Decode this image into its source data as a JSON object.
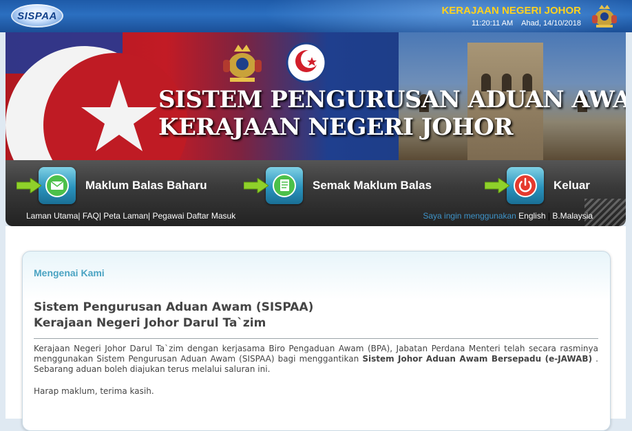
{
  "header": {
    "logo_text": "SISPAA",
    "state_name": "KERAJAAN NEGERI JOHOR",
    "time": "11:20:11 AM",
    "date": "Ahad, 14/10/2018"
  },
  "banner": {
    "title_line1": "SISTEM PENGURUSAN ADUAN AWAM",
    "title_line2": "KERAJAAN NEGERI JOHOR"
  },
  "nav": {
    "items": [
      {
        "label": "Maklum Balas Baharu",
        "icon": "envelope-icon"
      },
      {
        "label": "Semak Maklum Balas",
        "icon": "document-icon"
      },
      {
        "label": "Keluar",
        "icon": "power-icon"
      }
    ],
    "links": {
      "home": "Laman Utama",
      "faq": "FAQ",
      "sitemap": "Peta Laman",
      "officer": "Pegawai Daftar Masuk"
    },
    "lang_prompt": "Saya ingin menggunakan",
    "lang_en": "English",
    "lang_ms": "B.Malaysia"
  },
  "content": {
    "section_title": "Mengenai Kami",
    "heading_line1": "Sistem Pengurusan Aduan Awam (SISPAA)",
    "heading_line2": "Kerajaan Negeri Johor Darul Ta`zim",
    "para_part1": "Kerajaan Negeri Johor Darul Ta`zim dengan kerjasama Biro Pengaduan Awam (BPA), Jabatan Perdana Menteri telah secara rasminya menggunakan Sistem Pengurusan Aduan Awam (SISPAA)  bagi menggantikan",
    "para_bold": "Sistem Johor Aduan Awam Bersepadu (e-JAWAB)",
    "para_part2": ". Sebarang aduan boleh diajukan terus melalui saluran ini.",
    "closing": "Harap maklum, terima kasih."
  },
  "colors": {
    "state_name": "#ffd21f",
    "section_title": "#4aa3c2",
    "lang_prompt": "#3e93c8"
  }
}
